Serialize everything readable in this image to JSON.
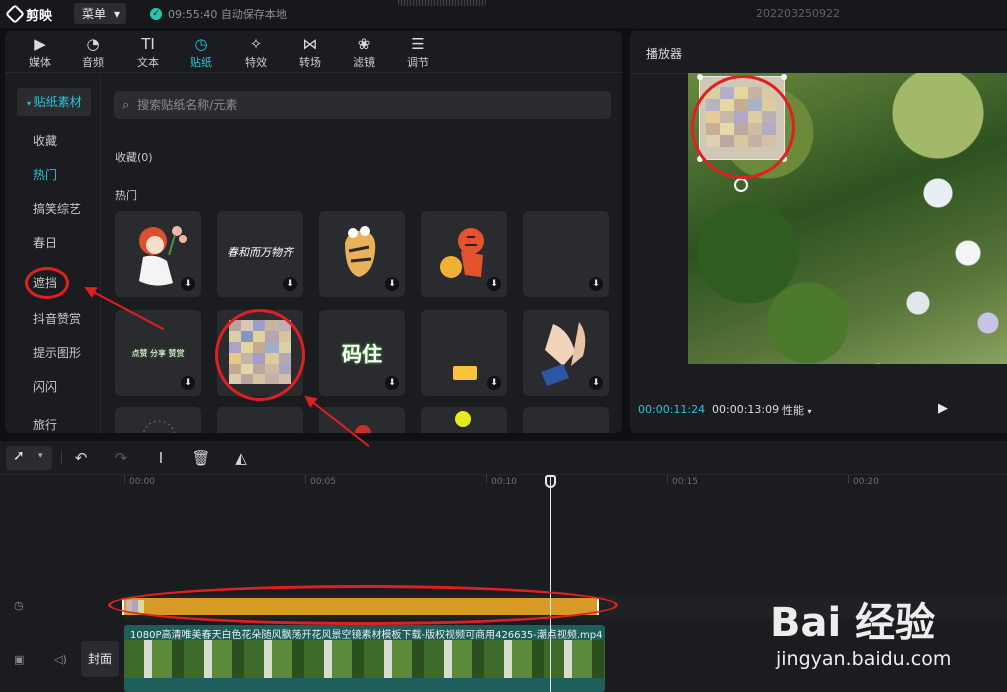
{
  "app": {
    "logo_text": "剪映",
    "menu_label": "菜单",
    "save_status": "09:55:40 自动保存本地",
    "project_title": "202203250922"
  },
  "tabs": [
    {
      "label": "媒体",
      "icon": "media-icon"
    },
    {
      "label": "音频",
      "icon": "audio-icon"
    },
    {
      "label": "文本",
      "icon": "text-icon",
      "glyph": "TI"
    },
    {
      "label": "贴纸",
      "icon": "sticker-icon",
      "active": true
    },
    {
      "label": "特效",
      "icon": "effects-icon"
    },
    {
      "label": "转场",
      "icon": "transition-icon"
    },
    {
      "label": "滤镜",
      "icon": "filter-icon"
    },
    {
      "label": "调节",
      "icon": "adjust-icon"
    }
  ],
  "categories": {
    "header": "贴纸素材",
    "items": [
      "收藏",
      "热门",
      "搞笑综艺",
      "春日",
      "遮挡",
      "抖音赞赏",
      "提示图形",
      "闪闪",
      "旅行"
    ]
  },
  "search": {
    "placeholder": "搜索贴纸名称/元素"
  },
  "sections": {
    "favorites": "收藏(0)",
    "hot": "热门"
  },
  "sticker_texts": {
    "spring_script": "春和而万物齐",
    "follow_share_like": "点赞 分享 赞赏",
    "code_it": "码住"
  },
  "player": {
    "title": "播放器",
    "current_time": "00:00:11:24",
    "total_time": "00:00:13:09",
    "performance": "性能"
  },
  "timeline": {
    "ruler": [
      "00:00",
      "00:05",
      "00:10",
      "00:15",
      "00:20"
    ],
    "video_name": "1080P高清唯美春天白色花朵随风飘荡开花风景空镜素材模板下载-版权视频可商用426635-潮点视频.mp4",
    "cover_label": "封面"
  },
  "watermark": {
    "main": "Bai 经验",
    "sub": "jingyan.baidu.com"
  },
  "colors": {
    "accent": "#26c6da",
    "sticker_clip": "#d89a27",
    "annotation": "#e02020",
    "video_clip": "#1d5d5a"
  }
}
